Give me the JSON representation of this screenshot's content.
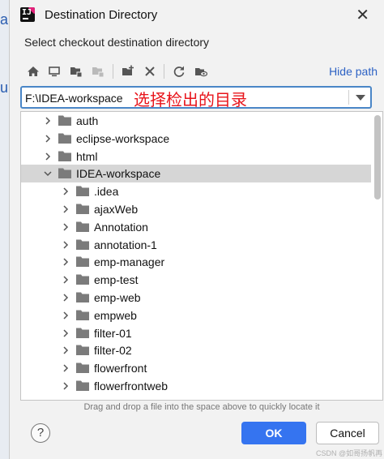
{
  "background_window": {
    "fragments": [
      "a",
      "u"
    ]
  },
  "dialog": {
    "title": "Destination Directory",
    "close_glyph": "✕",
    "subtitle": "Select checkout destination directory",
    "hide_path": "Hide path",
    "path_value": "F:\\IDEA-workspace",
    "annotation": "选择检出的目录",
    "hint": "Drag and drop a file into the space above to quickly locate it",
    "help_label": "?",
    "ok_label": "OK",
    "cancel_label": "Cancel",
    "watermark": "CSDN @如哥扬帆再"
  },
  "toolbar_icons": [
    "home-icon",
    "desktop-icon",
    "project-folder-icon",
    "module-folder-icon",
    "new-folder-icon",
    "delete-icon",
    "refresh-icon",
    "show-hidden-icon"
  ],
  "tree": {
    "items": [
      {
        "label": "auth",
        "depth": 0,
        "expanded": false,
        "selected": false
      },
      {
        "label": "eclipse-workspace",
        "depth": 0,
        "expanded": false,
        "selected": false
      },
      {
        "label": "html",
        "depth": 0,
        "expanded": false,
        "selected": false
      },
      {
        "label": "IDEA-workspace",
        "depth": 0,
        "expanded": true,
        "selected": true
      },
      {
        "label": ".idea",
        "depth": 1,
        "expanded": false,
        "selected": false
      },
      {
        "label": "ajaxWeb",
        "depth": 1,
        "expanded": false,
        "selected": false
      },
      {
        "label": "Annotation",
        "depth": 1,
        "expanded": false,
        "selected": false
      },
      {
        "label": "annotation-1",
        "depth": 1,
        "expanded": false,
        "selected": false
      },
      {
        "label": "emp-manager",
        "depth": 1,
        "expanded": false,
        "selected": false
      },
      {
        "label": "emp-test",
        "depth": 1,
        "expanded": false,
        "selected": false
      },
      {
        "label": "emp-web",
        "depth": 1,
        "expanded": false,
        "selected": false
      },
      {
        "label": "empweb",
        "depth": 1,
        "expanded": false,
        "selected": false
      },
      {
        "label": "filter-01",
        "depth": 1,
        "expanded": false,
        "selected": false
      },
      {
        "label": "filter-02",
        "depth": 1,
        "expanded": false,
        "selected": false
      },
      {
        "label": "flowerfront",
        "depth": 1,
        "expanded": false,
        "selected": false
      },
      {
        "label": "flowerfrontweb",
        "depth": 1,
        "expanded": false,
        "selected": false
      }
    ]
  },
  "colors": {
    "accent": "#3574f0",
    "link": "#2d62c4",
    "annotation": "#e8141b",
    "selection": "#d6d6d6",
    "folder": "#7b7b7b"
  }
}
